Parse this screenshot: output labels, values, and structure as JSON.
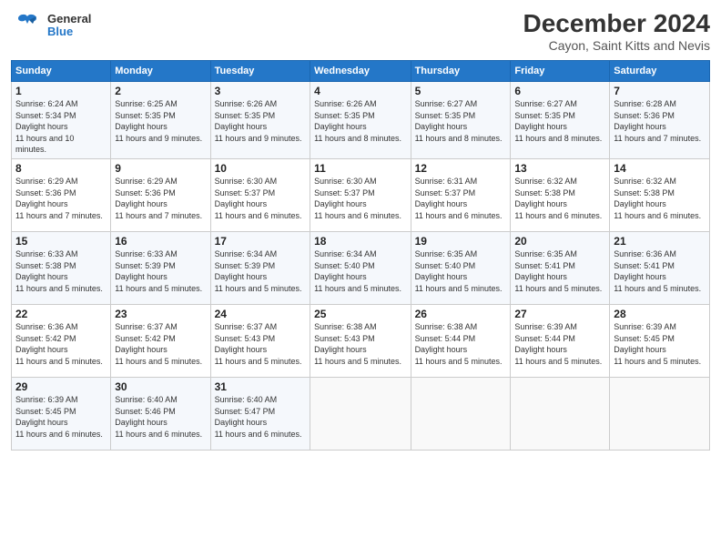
{
  "logo": {
    "line1": "General",
    "line2": "Blue"
  },
  "title": "December 2024",
  "location": "Cayon, Saint Kitts and Nevis",
  "days_of_week": [
    "Sunday",
    "Monday",
    "Tuesday",
    "Wednesday",
    "Thursday",
    "Friday",
    "Saturday"
  ],
  "weeks": [
    [
      {
        "day": "1",
        "sunrise": "6:24 AM",
        "sunset": "5:34 PM",
        "daylight": "11 hours and 10 minutes."
      },
      {
        "day": "2",
        "sunrise": "6:25 AM",
        "sunset": "5:35 PM",
        "daylight": "11 hours and 9 minutes."
      },
      {
        "day": "3",
        "sunrise": "6:26 AM",
        "sunset": "5:35 PM",
        "daylight": "11 hours and 9 minutes."
      },
      {
        "day": "4",
        "sunrise": "6:26 AM",
        "sunset": "5:35 PM",
        "daylight": "11 hours and 8 minutes."
      },
      {
        "day": "5",
        "sunrise": "6:27 AM",
        "sunset": "5:35 PM",
        "daylight": "11 hours and 8 minutes."
      },
      {
        "day": "6",
        "sunrise": "6:27 AM",
        "sunset": "5:35 PM",
        "daylight": "11 hours and 8 minutes."
      },
      {
        "day": "7",
        "sunrise": "6:28 AM",
        "sunset": "5:36 PM",
        "daylight": "11 hours and 7 minutes."
      }
    ],
    [
      {
        "day": "8",
        "sunrise": "6:29 AM",
        "sunset": "5:36 PM",
        "daylight": "11 hours and 7 minutes."
      },
      {
        "day": "9",
        "sunrise": "6:29 AM",
        "sunset": "5:36 PM",
        "daylight": "11 hours and 7 minutes."
      },
      {
        "day": "10",
        "sunrise": "6:30 AM",
        "sunset": "5:37 PM",
        "daylight": "11 hours and 6 minutes."
      },
      {
        "day": "11",
        "sunrise": "6:30 AM",
        "sunset": "5:37 PM",
        "daylight": "11 hours and 6 minutes."
      },
      {
        "day": "12",
        "sunrise": "6:31 AM",
        "sunset": "5:37 PM",
        "daylight": "11 hours and 6 minutes."
      },
      {
        "day": "13",
        "sunrise": "6:32 AM",
        "sunset": "5:38 PM",
        "daylight": "11 hours and 6 minutes."
      },
      {
        "day": "14",
        "sunrise": "6:32 AM",
        "sunset": "5:38 PM",
        "daylight": "11 hours and 6 minutes."
      }
    ],
    [
      {
        "day": "15",
        "sunrise": "6:33 AM",
        "sunset": "5:38 PM",
        "daylight": "11 hours and 5 minutes."
      },
      {
        "day": "16",
        "sunrise": "6:33 AM",
        "sunset": "5:39 PM",
        "daylight": "11 hours and 5 minutes."
      },
      {
        "day": "17",
        "sunrise": "6:34 AM",
        "sunset": "5:39 PM",
        "daylight": "11 hours and 5 minutes."
      },
      {
        "day": "18",
        "sunrise": "6:34 AM",
        "sunset": "5:40 PM",
        "daylight": "11 hours and 5 minutes."
      },
      {
        "day": "19",
        "sunrise": "6:35 AM",
        "sunset": "5:40 PM",
        "daylight": "11 hours and 5 minutes."
      },
      {
        "day": "20",
        "sunrise": "6:35 AM",
        "sunset": "5:41 PM",
        "daylight": "11 hours and 5 minutes."
      },
      {
        "day": "21",
        "sunrise": "6:36 AM",
        "sunset": "5:41 PM",
        "daylight": "11 hours and 5 minutes."
      }
    ],
    [
      {
        "day": "22",
        "sunrise": "6:36 AM",
        "sunset": "5:42 PM",
        "daylight": "11 hours and 5 minutes."
      },
      {
        "day": "23",
        "sunrise": "6:37 AM",
        "sunset": "5:42 PM",
        "daylight": "11 hours and 5 minutes."
      },
      {
        "day": "24",
        "sunrise": "6:37 AM",
        "sunset": "5:43 PM",
        "daylight": "11 hours and 5 minutes."
      },
      {
        "day": "25",
        "sunrise": "6:38 AM",
        "sunset": "5:43 PM",
        "daylight": "11 hours and 5 minutes."
      },
      {
        "day": "26",
        "sunrise": "6:38 AM",
        "sunset": "5:44 PM",
        "daylight": "11 hours and 5 minutes."
      },
      {
        "day": "27",
        "sunrise": "6:39 AM",
        "sunset": "5:44 PM",
        "daylight": "11 hours and 5 minutes."
      },
      {
        "day": "28",
        "sunrise": "6:39 AM",
        "sunset": "5:45 PM",
        "daylight": "11 hours and 5 minutes."
      }
    ],
    [
      {
        "day": "29",
        "sunrise": "6:39 AM",
        "sunset": "5:45 PM",
        "daylight": "11 hours and 6 minutes."
      },
      {
        "day": "30",
        "sunrise": "6:40 AM",
        "sunset": "5:46 PM",
        "daylight": "11 hours and 6 minutes."
      },
      {
        "day": "31",
        "sunrise": "6:40 AM",
        "sunset": "5:47 PM",
        "daylight": "11 hours and 6 minutes."
      },
      null,
      null,
      null,
      null
    ]
  ]
}
